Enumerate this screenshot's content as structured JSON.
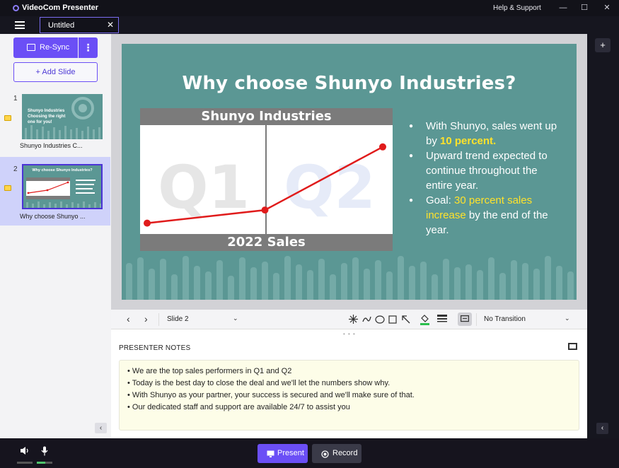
{
  "titlebar": {
    "app_name": "VideoCom Presenter",
    "help_link": "Help & Support",
    "minimize": "—",
    "maximize": "☐",
    "close": "✕"
  },
  "tab": {
    "label": "Untitled",
    "close": "✕"
  },
  "sidebar": {
    "resync_label": "Re-Sync",
    "more": "⋮",
    "add_slide_label": "+ Add Slide",
    "slides": [
      {
        "number": "1",
        "caption": "Shunyo Industries C...",
        "thumb_title": "Shunyo Industries Choosing the right one for you!"
      },
      {
        "number": "2",
        "caption": "Why choose Shunyo ...",
        "thumb_title": "Why choose Shunyo Industries?"
      }
    ],
    "collapse": "‹"
  },
  "slide": {
    "title": "Why choose Shunyo Industries?",
    "bullets": [
      {
        "pre": "With Shunyo, sales went up by ",
        "highlight": "10 percent.",
        "post": ""
      },
      {
        "pre": "Upward trend expected to continue throughout the entire year.",
        "highlight": "",
        "post": ""
      },
      {
        "pre": "Goal: ",
        "highlight": "30 percent sales increase",
        "post": " by the end of the year."
      }
    ],
    "colors": {
      "background": "#5b9794",
      "highlight": "#ffe22b",
      "line": "#e01b1b"
    }
  },
  "chart_data": {
    "type": "line",
    "title": "Shunyo Industries",
    "xlabel": "2022 Sales",
    "categories": [
      "Q1",
      "Q2"
    ],
    "values": [
      0.1,
      0.22,
      0.8
    ]
  },
  "toolbar": {
    "prev": "‹",
    "next": "›",
    "slide_select": "Slide 2",
    "caret": "⌄",
    "transition": "No Transition"
  },
  "notes": {
    "heading": "PRESENTER NOTES",
    "lines": [
      "• We are the top sales performers in Q1 and Q2",
      "• Today is the best day to close the deal and we'll let the numbers show why.",
      "• With Shunyo as your partner, your success is secured and we'll make sure of that.",
      "• Our dedicated staff and support are available 24/7 to assist you"
    ]
  },
  "right_rail": {
    "add": "+",
    "expand": "‹"
  },
  "bottom": {
    "speaker_icon": "speaker-icon",
    "mic_icon": "mic-icon",
    "present_label": "Present",
    "record_label": "Record",
    "accent": "#6b4ff6"
  }
}
